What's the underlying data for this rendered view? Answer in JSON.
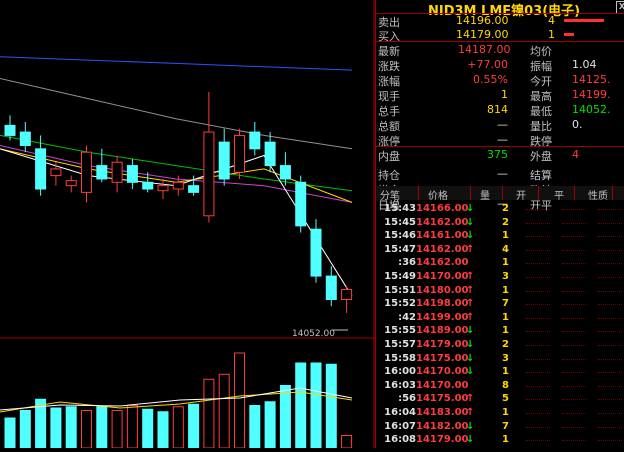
{
  "header": {
    "symbol": "NID3M",
    "name": "LME镍03(电子)",
    "icon_label": "X"
  },
  "order_book": [
    {
      "label": "卖出",
      "price": "14196.00",
      "qty": "4",
      "bar": 0.8
    },
    {
      "label": "买入",
      "price": "14179.00",
      "qty": "1",
      "bar": 0.2
    }
  ],
  "quote": {
    "left": [
      {
        "label": "最新",
        "value": "14187.00",
        "color": "red"
      },
      {
        "label": "涨跌",
        "value": "+77.00",
        "color": "red"
      },
      {
        "label": "涨幅",
        "value": "0.55%",
        "color": "red"
      },
      {
        "label": "现手",
        "value": "1",
        "color": "yel"
      },
      {
        "label": "总手",
        "value": "814",
        "color": "yel"
      },
      {
        "label": "总额",
        "value": "—",
        "color": "wht"
      },
      {
        "label": "涨停",
        "value": "—",
        "color": "wht"
      },
      {
        "label": "内盘",
        "value": "375",
        "color": "grn"
      },
      {
        "label": "持仓",
        "value": "—",
        "color": "wht"
      },
      {
        "label": "增仓",
        "value": "—",
        "color": "wht"
      },
      {
        "label": "日增",
        "value": "—",
        "color": "wht"
      }
    ],
    "right": [
      {
        "label": "均价",
        "value": "",
        "color": "wht"
      },
      {
        "label": "振幅",
        "value": "1.04",
        "color": "wht"
      },
      {
        "label": "今开",
        "value": "14125.",
        "color": "red"
      },
      {
        "label": "最高",
        "value": "14199.",
        "color": "red"
      },
      {
        "label": "最低",
        "value": "14052.",
        "color": "grn"
      },
      {
        "label": "量比",
        "value": "0.",
        "color": "wht"
      },
      {
        "label": "跌停",
        "value": "",
        "color": "wht"
      },
      {
        "label": "外盘",
        "value": "4",
        "color": "red"
      },
      {
        "label": "结算",
        "value": "",
        "color": "wht"
      },
      {
        "label": "昨结",
        "value": "",
        "color": "wht"
      },
      {
        "label": "开平",
        "value": "",
        "color": "wht"
      }
    ]
  },
  "trade_table": {
    "headers": [
      "分笔",
      "价格",
      "量",
      "开",
      "平",
      "性质"
    ],
    "rows": [
      {
        "time": "15:43",
        "price": "14166.00",
        "dir": "down",
        "qty": "2"
      },
      {
        "time": "15:45",
        "price": "14162.00",
        "dir": "down",
        "qty": "2"
      },
      {
        "time": "15:46",
        "price": "14161.00",
        "dir": "down",
        "qty": "1"
      },
      {
        "time": "15:47",
        "price": "14162.00",
        "dir": "up",
        "qty": "4"
      },
      {
        "time": ":36",
        "price": "14162.00",
        "dir": "none",
        "qty": "1"
      },
      {
        "time": "15:49",
        "price": "14170.00",
        "dir": "up",
        "qty": "3"
      },
      {
        "time": "15:51",
        "price": "14180.00",
        "dir": "up",
        "qty": "1"
      },
      {
        "time": "15:52",
        "price": "14198.00",
        "dir": "up",
        "qty": "7"
      },
      {
        "time": ":42",
        "price": "14199.00",
        "dir": "up",
        "qty": "1"
      },
      {
        "time": "15:55",
        "price": "14189.00",
        "dir": "down",
        "qty": "1"
      },
      {
        "time": "15:57",
        "price": "14179.00",
        "dir": "down",
        "qty": "2"
      },
      {
        "time": "15:58",
        "price": "14175.00",
        "dir": "down",
        "qty": "3"
      },
      {
        "time": "16:00",
        "price": "14170.00",
        "dir": "down",
        "qty": "1"
      },
      {
        "time": "16:03",
        "price": "14170.00",
        "dir": "none",
        "qty": "8"
      },
      {
        "time": ":56",
        "price": "14175.00",
        "dir": "up",
        "qty": "5"
      },
      {
        "time": "16:04",
        "price": "14183.00",
        "dir": "up",
        "qty": "1"
      },
      {
        "time": "16:07",
        "price": "14182.00",
        "dir": "down",
        "qty": "7"
      },
      {
        "time": "16:08",
        "price": "14179.00",
        "dir": "down",
        "qty": "1"
      }
    ]
  },
  "chart_data": {
    "type": "candlestick",
    "low_label": "14052.00",
    "y_range": [
      14040,
      14215
    ],
    "candles": [
      {
        "o": 14164,
        "h": 14170,
        "l": 14155,
        "c": 14158
      },
      {
        "o": 14160,
        "h": 14166,
        "l": 14148,
        "c": 14152
      },
      {
        "o": 14150,
        "h": 14158,
        "l": 14122,
        "c": 14126
      },
      {
        "o": 14134,
        "h": 14142,
        "l": 14128,
        "c": 14138
      },
      {
        "o": 14128,
        "h": 14134,
        "l": 14124,
        "c": 14131
      },
      {
        "o": 14124,
        "h": 14152,
        "l": 14118,
        "c": 14148
      },
      {
        "o": 14140,
        "h": 14150,
        "l": 14130,
        "c": 14132
      },
      {
        "o": 14130,
        "h": 14146,
        "l": 14124,
        "c": 14142
      },
      {
        "o": 14140,
        "h": 14144,
        "l": 14126,
        "c": 14130
      },
      {
        "o": 14130,
        "h": 14136,
        "l": 14124,
        "c": 14126
      },
      {
        "o": 14125,
        "h": 14132,
        "l": 14120,
        "c": 14128
      },
      {
        "o": 14126,
        "h": 14134,
        "l": 14122,
        "c": 14130
      },
      {
        "o": 14128,
        "h": 14134,
        "l": 14122,
        "c": 14124
      },
      {
        "o": 14110,
        "h": 14184,
        "l": 14106,
        "c": 14160
      },
      {
        "o": 14154,
        "h": 14162,
        "l": 14128,
        "c": 14132
      },
      {
        "o": 14136,
        "h": 14162,
        "l": 14132,
        "c": 14158
      },
      {
        "o": 14160,
        "h": 14166,
        "l": 14146,
        "c": 14150
      },
      {
        "o": 14154,
        "h": 14160,
        "l": 14136,
        "c": 14140
      },
      {
        "o": 14140,
        "h": 14148,
        "l": 14128,
        "c": 14132
      },
      {
        "o": 14130,
        "h": 14134,
        "l": 14100,
        "c": 14104
      },
      {
        "o": 14102,
        "h": 14108,
        "l": 14070,
        "c": 14074
      },
      {
        "o": 14074,
        "h": 14080,
        "l": 14056,
        "c": 14060
      },
      {
        "o": 14060,
        "h": 14068,
        "l": 14052,
        "c": 14066
      }
    ],
    "volumes": [
      {
        "v": 24,
        "up": false
      },
      {
        "v": 30,
        "up": false
      },
      {
        "v": 39,
        "up": false
      },
      {
        "v": 32,
        "up": false
      },
      {
        "v": 33,
        "up": false
      },
      {
        "v": 30,
        "up": true
      },
      {
        "v": 33,
        "up": false
      },
      {
        "v": 30,
        "up": true
      },
      {
        "v": 34,
        "up": true
      },
      {
        "v": 31,
        "up": false
      },
      {
        "v": 29,
        "up": false
      },
      {
        "v": 33,
        "up": true
      },
      {
        "v": 35,
        "up": false
      },
      {
        "v": 55,
        "up": true
      },
      {
        "v": 59,
        "up": true
      },
      {
        "v": 76,
        "up": true
      },
      {
        "v": 34,
        "up": false
      },
      {
        "v": 37,
        "up": false
      },
      {
        "v": 50,
        "up": false
      },
      {
        "v": 68,
        "up": false
      },
      {
        "v": 68,
        "up": false
      },
      {
        "v": 67,
        "up": false
      },
      {
        "v": 10,
        "up": true
      }
    ],
    "vol_max": 80,
    "ma_lines": [
      {
        "color": "#3050ff",
        "values": [
          14205,
          14203,
          14201,
          14199,
          14197
        ]
      },
      {
        "color": "#909090",
        "values": [
          14192,
          14180,
          14168,
          14158,
          14150
        ]
      },
      {
        "color": "#00c000",
        "values": [
          14158,
          14148,
          14140,
          14132,
          14125
        ]
      },
      {
        "color": "#d040d0",
        "values": [
          14152,
          14140,
          14132,
          14128,
          14118
        ]
      },
      {
        "color": "#ffd800",
        "values": [
          14150,
          14138,
          14130,
          14138,
          14118
        ]
      },
      {
        "color": "#ffffff",
        "values": [
          14150,
          14134,
          14128,
          14146,
          14062
        ]
      }
    ]
  }
}
